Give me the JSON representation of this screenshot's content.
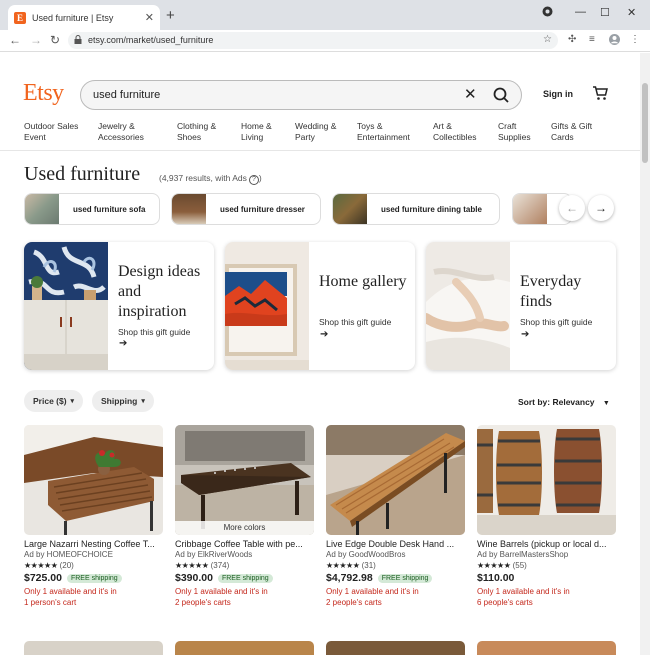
{
  "browser": {
    "tab_title": "Used furniture | Etsy",
    "favicon_letter": "E",
    "url": "etsy.com/market/used_furniture"
  },
  "header": {
    "logo": "Etsy",
    "search_value": "used furniture",
    "sign_in": "Sign in"
  },
  "categories": [
    "Outdoor Sales Event",
    "Jewelry & Accessories",
    "Clothing & Shoes",
    "Home & Living",
    "Wedding & Party",
    "Toys & Entertainment",
    "Art & Collectibles",
    "Craft Supplies",
    "Gifts & Gift Cards"
  ],
  "results": {
    "title": "Used furniture",
    "count": "(4,937 results, with Ads"
  },
  "related_searches": [
    "used furniture sofa",
    "used furniture dresser",
    "used furniture dining table"
  ],
  "gift_guides": [
    {
      "title": "Design ideas and inspiration",
      "sub": "Shop this gift guide"
    },
    {
      "title": "Home gallery",
      "sub": "Shop this gift guide"
    },
    {
      "title": "Everyday finds",
      "sub": "Shop this gift guide"
    }
  ],
  "filters": {
    "price": "Price ($)",
    "shipping": "Shipping",
    "sort": "Sort by: Relevancy"
  },
  "listings": [
    {
      "title": "Large Nazarri Nesting Coffee T...",
      "seller": "Ad by HOMEOFCHOICE",
      "stars": "★★★★★",
      "reviews": "(20)",
      "price": "$725.00",
      "free": "FREE shipping",
      "stock1": "Only 1 available and it's in",
      "stock2": "1 person's cart",
      "more_colors": ""
    },
    {
      "title": "Cribbage Coffee Table with pe...",
      "seller": "Ad by ElkRiverWoods",
      "stars": "★★★★★",
      "reviews": "(374)",
      "price": "$390.00",
      "free": "FREE shipping",
      "stock1": "Only 1 available and it's in",
      "stock2": "2 people's carts",
      "more_colors": "More colors"
    },
    {
      "title": "Live Edge Double Desk Hand ...",
      "seller": "Ad by GoodWoodBros",
      "stars": "★★★★★",
      "reviews": "(31)",
      "price": "$4,792.98",
      "free": "FREE shipping",
      "stock1": "Only 1 available and it's in",
      "stock2": "2 people's carts",
      "more_colors": ""
    },
    {
      "title": "Wine Barrels (pickup or local d...",
      "seller": "Ad by BarrelMastersShop",
      "stars": "★★★★★",
      "reviews": "(55)",
      "price": "$110.00",
      "free": "",
      "stock1": "Only 1 available and it's in",
      "stock2": "6 people's carts",
      "more_colors": ""
    }
  ],
  "colors": {
    "brand": "#f1641e",
    "stock_warning": "#c4281c",
    "free_shipping_bg": "#d4e9d7"
  }
}
